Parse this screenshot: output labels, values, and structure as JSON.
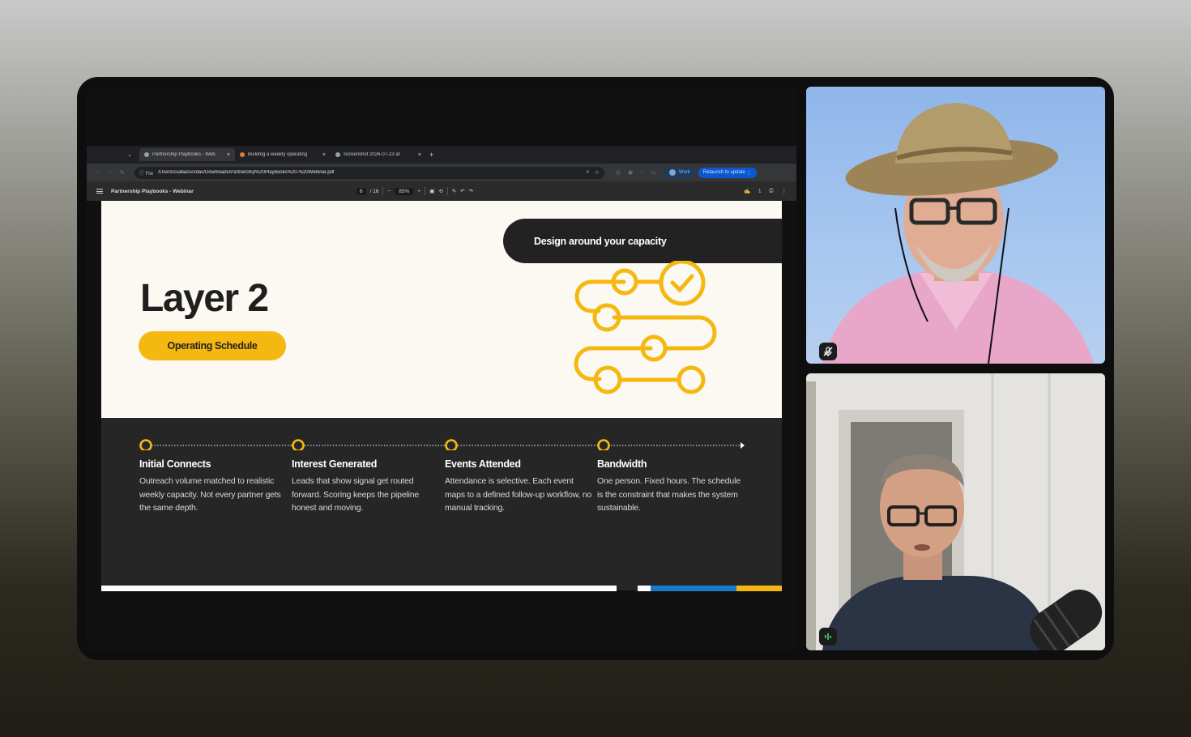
{
  "browser": {
    "tabs": [
      {
        "label": "Partnership Playbooks - Web",
        "active": true
      },
      {
        "label": "Building a weekly operating",
        "active": false
      },
      {
        "label": "Screenshot 2026-07-23 at",
        "active": false
      }
    ],
    "new_tab": "+",
    "file_chip": "File",
    "url": "/Users/csabacsordas/Downloads/Partnership%20Playbooks%20-%20Webinar.pdf",
    "profile_label": "Work",
    "relaunch_label": "Relaunch to update"
  },
  "pdf_toolbar": {
    "title": "Partnership Playbooks - Webinar",
    "page_current": "6",
    "page_total": "/ 16",
    "zoom": "85%"
  },
  "slide": {
    "title": "Layer 2",
    "pill_label": "Operating Schedule",
    "banner": "Design around your capacity",
    "stages": [
      {
        "title": "Initial Connects",
        "text": "Outreach volume matched to realistic weekly capacity. Not every partner gets the same depth."
      },
      {
        "title": "Interest Generated",
        "text": "Leads that show signal get routed forward. Scoring keeps the pipeline honest and moving."
      },
      {
        "title": "Events Attended",
        "text": "Attendance is selective. Each event maps to a defined follow-up workflow, no manual tracking."
      },
      {
        "title": "Bandwidth",
        "text": "One person. Fixed hours. The schedule is the constraint that makes the system sustainable."
      }
    ],
    "colors": {
      "accent": "#f5b811",
      "dark": "#262626",
      "paper": "#fbf9f1",
      "blue": "#1a7ac9"
    }
  },
  "participants": [
    {
      "name": "participant-1",
      "mic": "muted"
    },
    {
      "name": "participant-2",
      "mic": "speaking"
    }
  ]
}
